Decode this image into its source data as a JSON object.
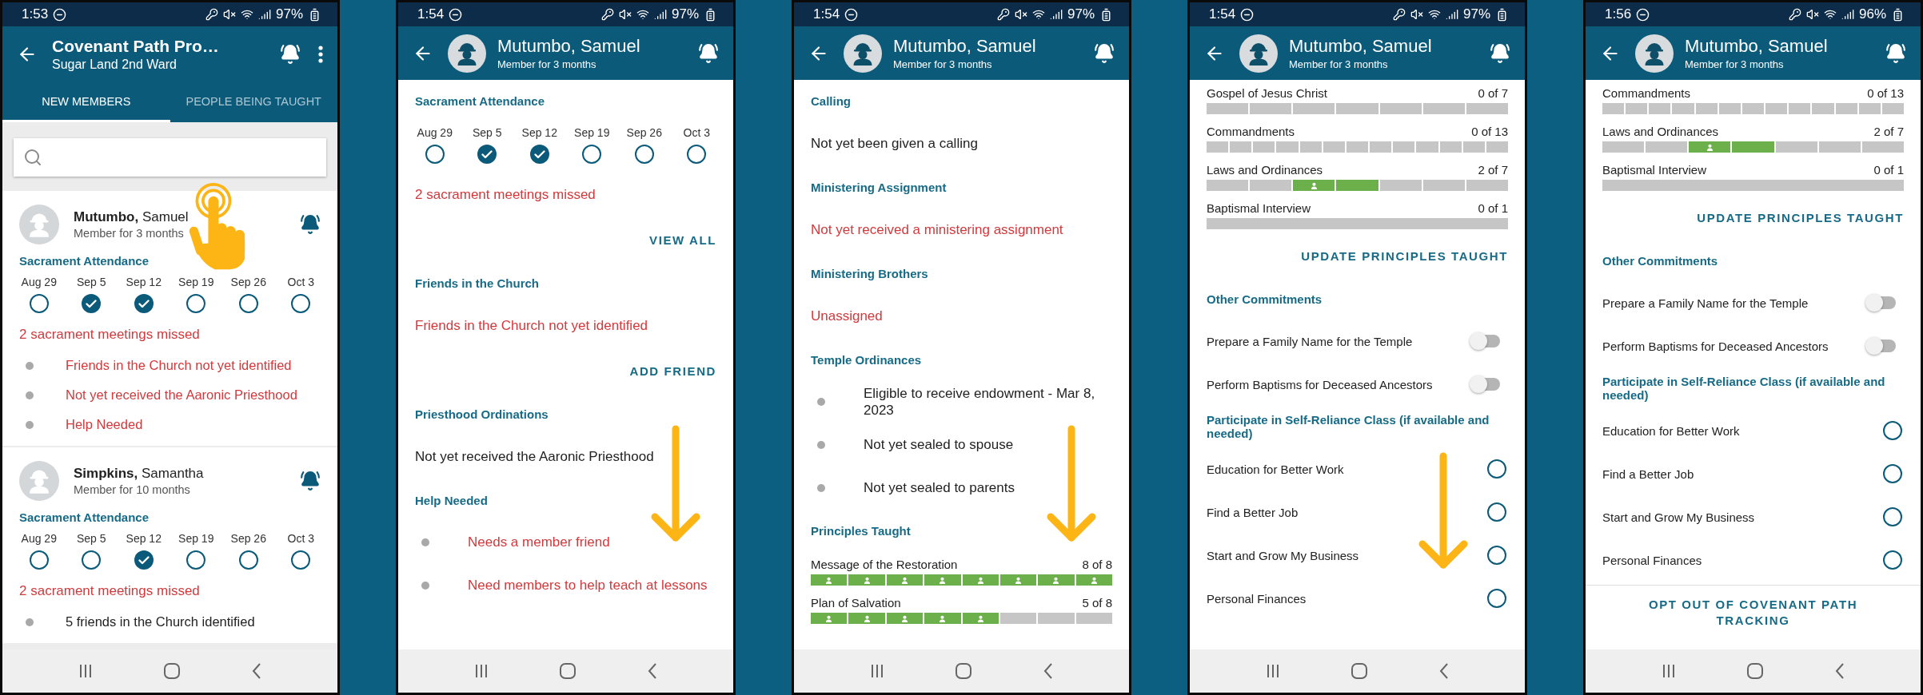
{
  "phones": [
    {
      "status": {
        "time": "1:53",
        "battery": "97%"
      },
      "header": {
        "kind": "list",
        "title": "Covenant Path Pro…",
        "subtitle": "Sugar Land 2nd Ward"
      },
      "tabs": [
        {
          "label": "NEW MEMBERS",
          "selected": true
        },
        {
          "label": "PEOPLE BEING TAUGHT",
          "selected": false
        }
      ],
      "blocks": [
        {
          "kind": "search"
        },
        {
          "kind": "member",
          "name": "**Mutumbo,** Samuel",
          "subtitle": "Member for 3 months",
          "attendance_title": "Sacrament Attendance",
          "attendance": [
            {
              "date": "Aug 29",
              "attended": false
            },
            {
              "date": "Sep 5",
              "attended": true
            },
            {
              "date": "Sep 12",
              "attended": true
            },
            {
              "date": "Sep 19",
              "attended": false
            },
            {
              "date": "Sep 26",
              "attended": false
            },
            {
              "date": "Oct 3",
              "attended": false
            }
          ],
          "missed": "2 sacrament meetings missed",
          "bullets": [
            {
              "text": "Friends in the Church not yet identified",
              "alert": true
            },
            {
              "text": "Not yet received the Aaronic Priesthood",
              "alert": true
            },
            {
              "text": "Help Needed",
              "alert": true
            }
          ]
        },
        {
          "kind": "member",
          "name": "**Simpkins,** Samantha",
          "subtitle": "Member for 10 months",
          "attendance_title": "Sacrament Attendance",
          "attendance": [
            {
              "date": "Aug 29",
              "attended": false
            },
            {
              "date": "Sep 5",
              "attended": false
            },
            {
              "date": "Sep 12",
              "attended": true
            },
            {
              "date": "Sep 19",
              "attended": false
            },
            {
              "date": "Sep 26",
              "attended": false
            },
            {
              "date": "Oct 3",
              "attended": false
            }
          ],
          "missed": "2 sacrament meetings missed",
          "bullets": [
            {
              "text": "5 friends in the Church identified",
              "alert": false
            }
          ]
        }
      ]
    },
    {
      "status": {
        "time": "1:54",
        "battery": "97%"
      },
      "header": {
        "kind": "profile",
        "title": "Mutumbo, Samuel",
        "subtitle": "Member for 3 months"
      },
      "blocks": [
        {
          "kind": "section",
          "text": "Sacrament Attendance"
        },
        {
          "kind": "attendance",
          "attendance": [
            {
              "date": "Aug 29",
              "attended": false
            },
            {
              "date": "Sep 5",
              "attended": true
            },
            {
              "date": "Sep 12",
              "attended": true
            },
            {
              "date": "Sep 19",
              "attended": false
            },
            {
              "date": "Sep 26",
              "attended": false
            },
            {
              "date": "Oct 3",
              "attended": false
            }
          ]
        },
        {
          "kind": "alert",
          "text": "2 sacrament meetings missed"
        },
        {
          "kind": "action",
          "text": "VIEW ALL"
        },
        {
          "kind": "section",
          "text": "Friends in the Church"
        },
        {
          "kind": "alert",
          "text": "Friends in the Church not yet identified"
        },
        {
          "kind": "action",
          "text": "ADD FRIEND"
        },
        {
          "kind": "section",
          "text": "Priesthood Ordinations"
        },
        {
          "kind": "text",
          "text": "Not yet received the Aaronic Priesthood"
        },
        {
          "kind": "section",
          "text": "Help Needed"
        },
        {
          "kind": "bullet",
          "text": "Needs a member friend",
          "alert": true
        },
        {
          "kind": "bullet",
          "text": "Need members to help teach at lessons",
          "alert": true
        }
      ]
    },
    {
      "status": {
        "time": "1:54",
        "battery": "97%"
      },
      "header": {
        "kind": "profile",
        "title": "Mutumbo, Samuel",
        "subtitle": "Member for 3 months"
      },
      "blocks": [
        {
          "kind": "section",
          "text": "Calling"
        },
        {
          "kind": "text",
          "text": "Not yet been given a calling"
        },
        {
          "kind": "section",
          "text": "Ministering Assignment"
        },
        {
          "kind": "alert",
          "text": "Not yet received a ministering assignment"
        },
        {
          "kind": "section",
          "text": "Ministering Brothers"
        },
        {
          "kind": "alert",
          "text": "Unassigned"
        },
        {
          "kind": "section",
          "text": "Temple Ordinances"
        },
        {
          "kind": "bullet",
          "text": "Eligible to receive endowment - Mar 8, 2023",
          "alert": false
        },
        {
          "kind": "bullet",
          "text": "Not yet sealed to spouse",
          "alert": false
        },
        {
          "kind": "bullet",
          "text": "Not yet sealed to parents",
          "alert": false
        },
        {
          "kind": "section",
          "text": "Principles Taught"
        },
        {
          "kind": "progress",
          "label": "Message of the Restoration",
          "count": "8 of 8",
          "segments": [
            {
              "taught": true,
              "with_member": true
            },
            {
              "taught": true,
              "with_member": true
            },
            {
              "taught": true,
              "with_member": true
            },
            {
              "taught": true,
              "with_member": true
            },
            {
              "taught": true,
              "with_member": true
            },
            {
              "taught": true,
              "with_member": true
            },
            {
              "taught": true,
              "with_member": true
            },
            {
              "taught": true,
              "with_member": true
            }
          ]
        },
        {
          "kind": "progress",
          "label": "Plan of Salvation",
          "count": "5 of 8",
          "segments": [
            {
              "taught": true,
              "with_member": true
            },
            {
              "taught": true,
              "with_member": true
            },
            {
              "taught": true,
              "with_member": true
            },
            {
              "taught": true,
              "with_member": true
            },
            {
              "taught": true,
              "with_member": true
            },
            {
              "taught": false,
              "with_member": false
            },
            {
              "taught": false,
              "with_member": false
            },
            {
              "taught": false,
              "with_member": false
            }
          ]
        }
      ]
    },
    {
      "status": {
        "time": "1:54",
        "battery": "97%"
      },
      "header": {
        "kind": "profile",
        "title": "Mutumbo, Samuel",
        "subtitle": "Member for 3 months"
      },
      "blocks": [
        {
          "kind": "progress",
          "label": "Gospel of Jesus Christ",
          "count": "0 of 7",
          "segments": [
            {
              "taught": false,
              "with_member": false
            },
            {
              "taught": false,
              "with_member": false
            },
            {
              "taught": false,
              "with_member": false
            },
            {
              "taught": false,
              "with_member": false
            },
            {
              "taught": false,
              "with_member": false
            },
            {
              "taught": false,
              "with_member": false
            },
            {
              "taught": false,
              "with_member": false
            }
          ]
        },
        {
          "kind": "progress",
          "label": "Commandments",
          "count": "0 of 13",
          "segments": [
            {
              "taught": false,
              "with_member": false
            },
            {
              "taught": false,
              "with_member": false
            },
            {
              "taught": false,
              "with_member": false
            },
            {
              "taught": false,
              "with_member": false
            },
            {
              "taught": false,
              "with_member": false
            },
            {
              "taught": false,
              "with_member": false
            },
            {
              "taught": false,
              "with_member": false
            },
            {
              "taught": false,
              "with_member": false
            },
            {
              "taught": false,
              "with_member": false
            },
            {
              "taught": false,
              "with_member": false
            },
            {
              "taught": false,
              "with_member": false
            },
            {
              "taught": false,
              "with_member": false
            },
            {
              "taught": false,
              "with_member": false
            }
          ]
        },
        {
          "kind": "progress",
          "label": "Laws and Ordinances",
          "count": "2 of 7",
          "segments": [
            {
              "taught": false,
              "with_member": false
            },
            {
              "taught": false,
              "with_member": false
            },
            {
              "taught": true,
              "with_member": true
            },
            {
              "taught": true,
              "with_member": false
            },
            {
              "taught": false,
              "with_member": false
            },
            {
              "taught": false,
              "with_member": false
            },
            {
              "taught": false,
              "with_member": false
            }
          ]
        },
        {
          "kind": "progress",
          "label": "Baptismal Interview",
          "count": "0 of 1",
          "segments": [
            {
              "taught": false,
              "with_member": false
            }
          ]
        },
        {
          "kind": "action",
          "text": "UPDATE PRINCIPLES TAUGHT"
        },
        {
          "kind": "section",
          "text": "Other Commitments"
        },
        {
          "kind": "toggle",
          "text": "Prepare a Family Name for the Temple",
          "on": false
        },
        {
          "kind": "toggle",
          "text": "Perform Baptisms for Deceased Ancestors",
          "on": false
        },
        {
          "kind": "section",
          "text": "Participate in Self-Reliance Class (if available and needed)"
        },
        {
          "kind": "radio",
          "text": "Education for Better Work",
          "checked": false
        },
        {
          "kind": "radio",
          "text": "Find a Better Job",
          "checked": false
        },
        {
          "kind": "radio",
          "text": "Start and Grow My Business",
          "checked": false
        },
        {
          "kind": "radio",
          "text": "Personal Finances",
          "checked": false
        }
      ]
    },
    {
      "status": {
        "time": "1:56",
        "battery": "96%"
      },
      "header": {
        "kind": "profile",
        "title": "Mutumbo, Samuel",
        "subtitle": "Member for 3 months"
      },
      "blocks": [
        {
          "kind": "progress",
          "label": "Commandments",
          "count": "0 of 13",
          "segments": [
            {
              "taught": false,
              "with_member": false
            },
            {
              "taught": false,
              "with_member": false
            },
            {
              "taught": false,
              "with_member": false
            },
            {
              "taught": false,
              "with_member": false
            },
            {
              "taught": false,
              "with_member": false
            },
            {
              "taught": false,
              "with_member": false
            },
            {
              "taught": false,
              "with_member": false
            },
            {
              "taught": false,
              "with_member": false
            },
            {
              "taught": false,
              "with_member": false
            },
            {
              "taught": false,
              "with_member": false
            },
            {
              "taught": false,
              "with_member": false
            },
            {
              "taught": false,
              "with_member": false
            },
            {
              "taught": false,
              "with_member": false
            }
          ]
        },
        {
          "kind": "progress",
          "label": "Laws and Ordinances",
          "count": "2 of 7",
          "segments": [
            {
              "taught": false,
              "with_member": false
            },
            {
              "taught": false,
              "with_member": false
            },
            {
              "taught": true,
              "with_member": true
            },
            {
              "taught": true,
              "with_member": false
            },
            {
              "taught": false,
              "with_member": false
            },
            {
              "taught": false,
              "with_member": false
            },
            {
              "taught": false,
              "with_member": false
            }
          ]
        },
        {
          "kind": "progress",
          "label": "Baptismal Interview",
          "count": "0 of 1",
          "segments": [
            {
              "taught": false,
              "with_member": false
            }
          ]
        },
        {
          "kind": "action",
          "text": "UPDATE PRINCIPLES TAUGHT"
        },
        {
          "kind": "section",
          "text": "Other Commitments"
        },
        {
          "kind": "toggle",
          "text": "Prepare a Family Name for the Temple",
          "on": false
        },
        {
          "kind": "toggle",
          "text": "Perform Baptisms for Deceased Ancestors",
          "on": false
        },
        {
          "kind": "section",
          "text": "Participate in Self-Reliance Class (if available and needed)"
        },
        {
          "kind": "radio",
          "text": "Education for Better Work",
          "checked": false
        },
        {
          "kind": "radio",
          "text": "Find a Better Job",
          "checked": false
        },
        {
          "kind": "radio",
          "text": "Start and Grow My Business",
          "checked": false
        },
        {
          "kind": "radio",
          "text": "Personal Finances",
          "checked": false
        },
        {
          "kind": "footer_action",
          "text": "OPT OUT OF COVENANT PATH TRACKING"
        }
      ]
    }
  ]
}
